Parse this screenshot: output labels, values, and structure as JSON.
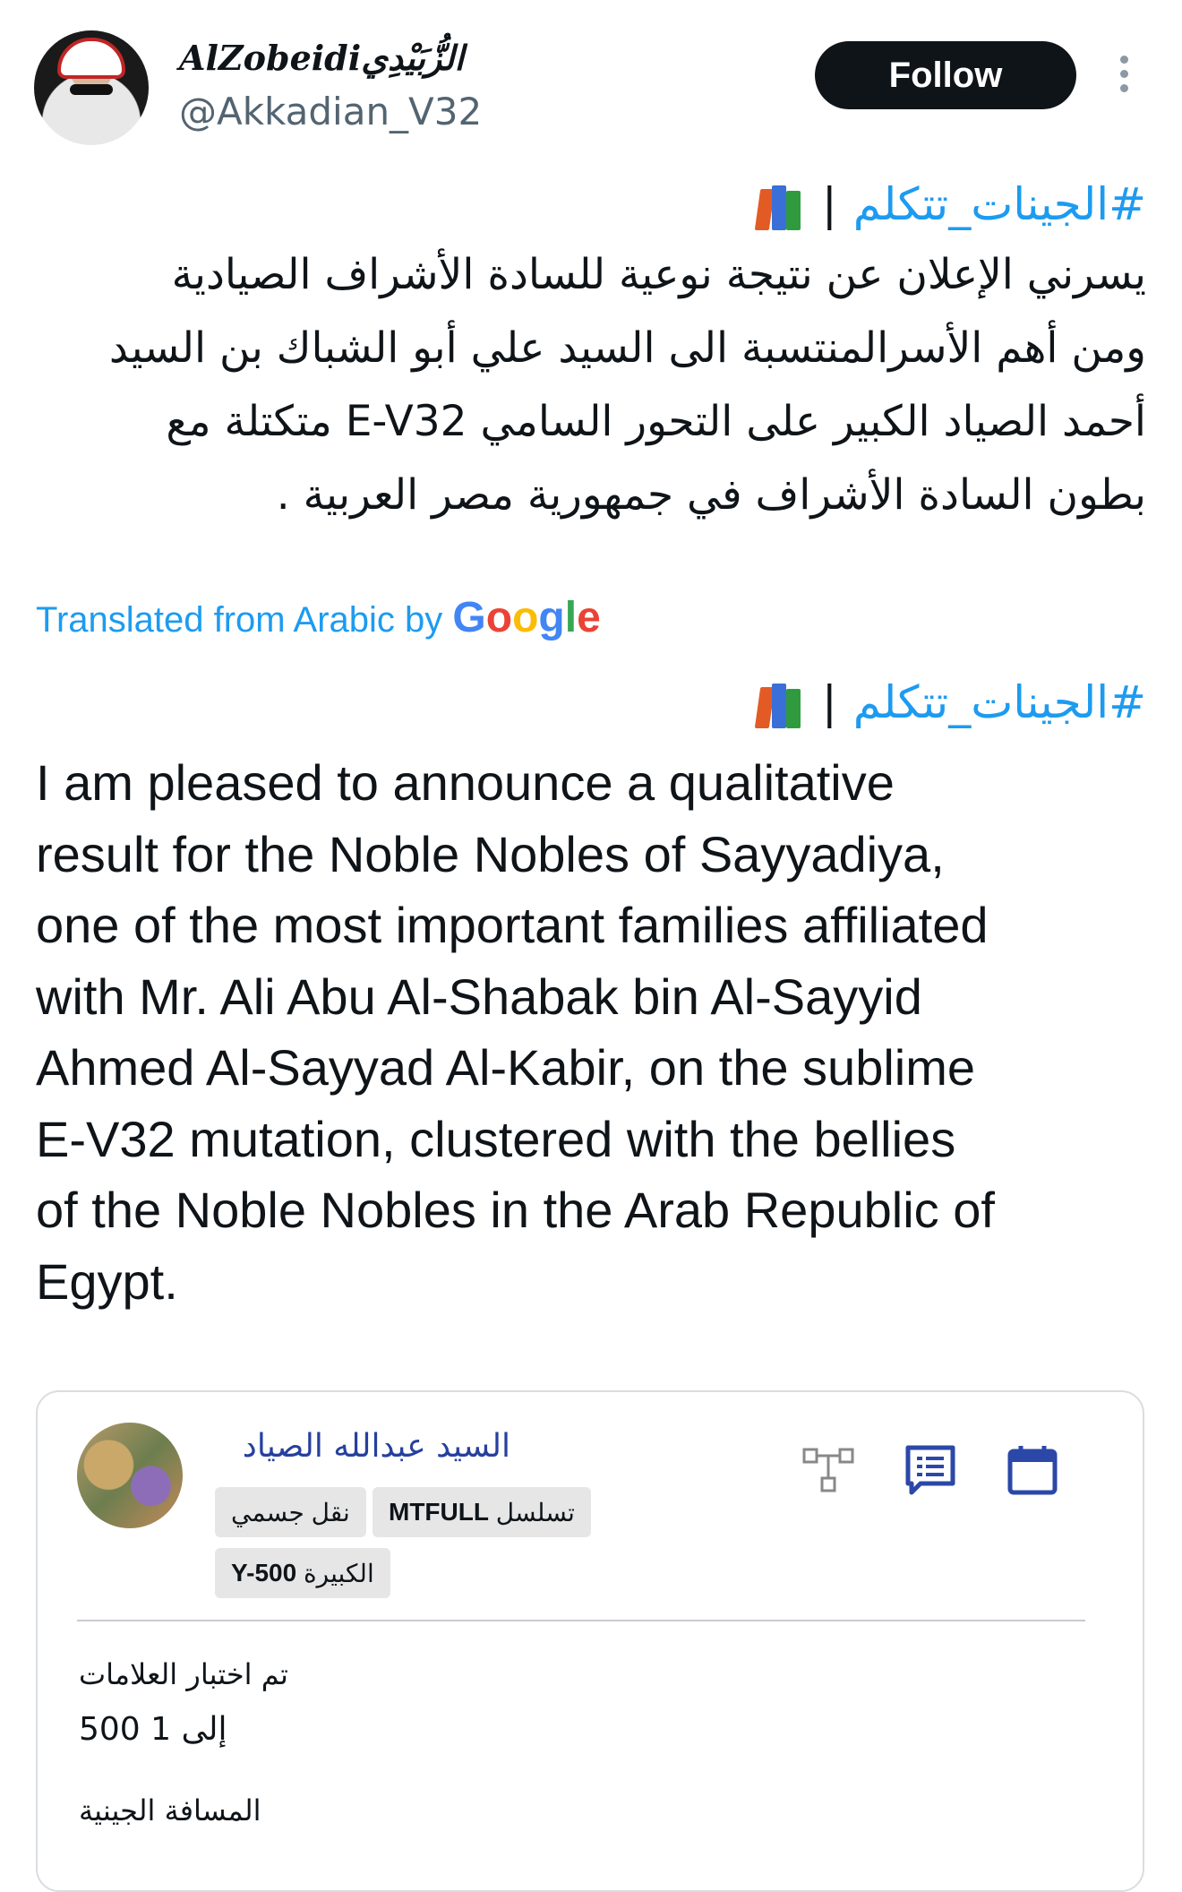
{
  "tweet": {
    "author": {
      "display_name": "AlZobeidiالزُّبَيْدِي",
      "handle": "@Akkadian_V32"
    },
    "follow_label": "Follow",
    "arabic": {
      "hashtag": "#الجينات_تتكلم",
      "separator": "|",
      "lines": [
        "يسرني الإعلان عن نتيجة نوعية للسادة الأشراف الصيادية",
        "ومن أهم الأسرالمنتسبة الى السيد علي أبو الشباك بن السيد",
        "أحمد الصياد الكبير على التحور السامي E-V32 متكتلة مع",
        "بطون السادة الأشراف في جمهورية مصر العربية ."
      ]
    },
    "translation_label": "Translated from Arabic by",
    "translation_brand": "Google",
    "english": {
      "hashtag": "#الجينات_تتكلم",
      "separator": "|",
      "lines": [
        "I am pleased to announce a qualitative",
        "result for the Noble Nobles of Sayyadiya,",
        "one of the most important families affiliated",
        "with Mr. Ali Abu Al-Shabak bin Al-Sayyid",
        "Ahmed Al-Sayyad Al-Kabir, on the sublime",
        "E-V32 mutation, clustered with the bellies",
        "of the Noble Nobles in the Arab Republic of",
        "Egypt."
      ]
    }
  },
  "card": {
    "name": "السيد عبدالله الصياد",
    "chips": {
      "autosomal": "نقل جسمي",
      "mtfull_code": "MTFULL",
      "mtfull_label": "تسلسل",
      "big_code": "Y-500",
      "big_label": "الكبيرة"
    },
    "markers_label": "تم اختبار العلامات",
    "markers_value": "إلى 1 500",
    "distance_label": "المسافة الجينية"
  },
  "colors": {
    "link_blue": "#1d9bf0",
    "card_name_blue": "#26409e",
    "follow_bg": "#0f1419"
  },
  "icons": [
    "books-icon",
    "more-dots-icon",
    "tree-icon",
    "report-icon",
    "calendar-icon"
  ]
}
